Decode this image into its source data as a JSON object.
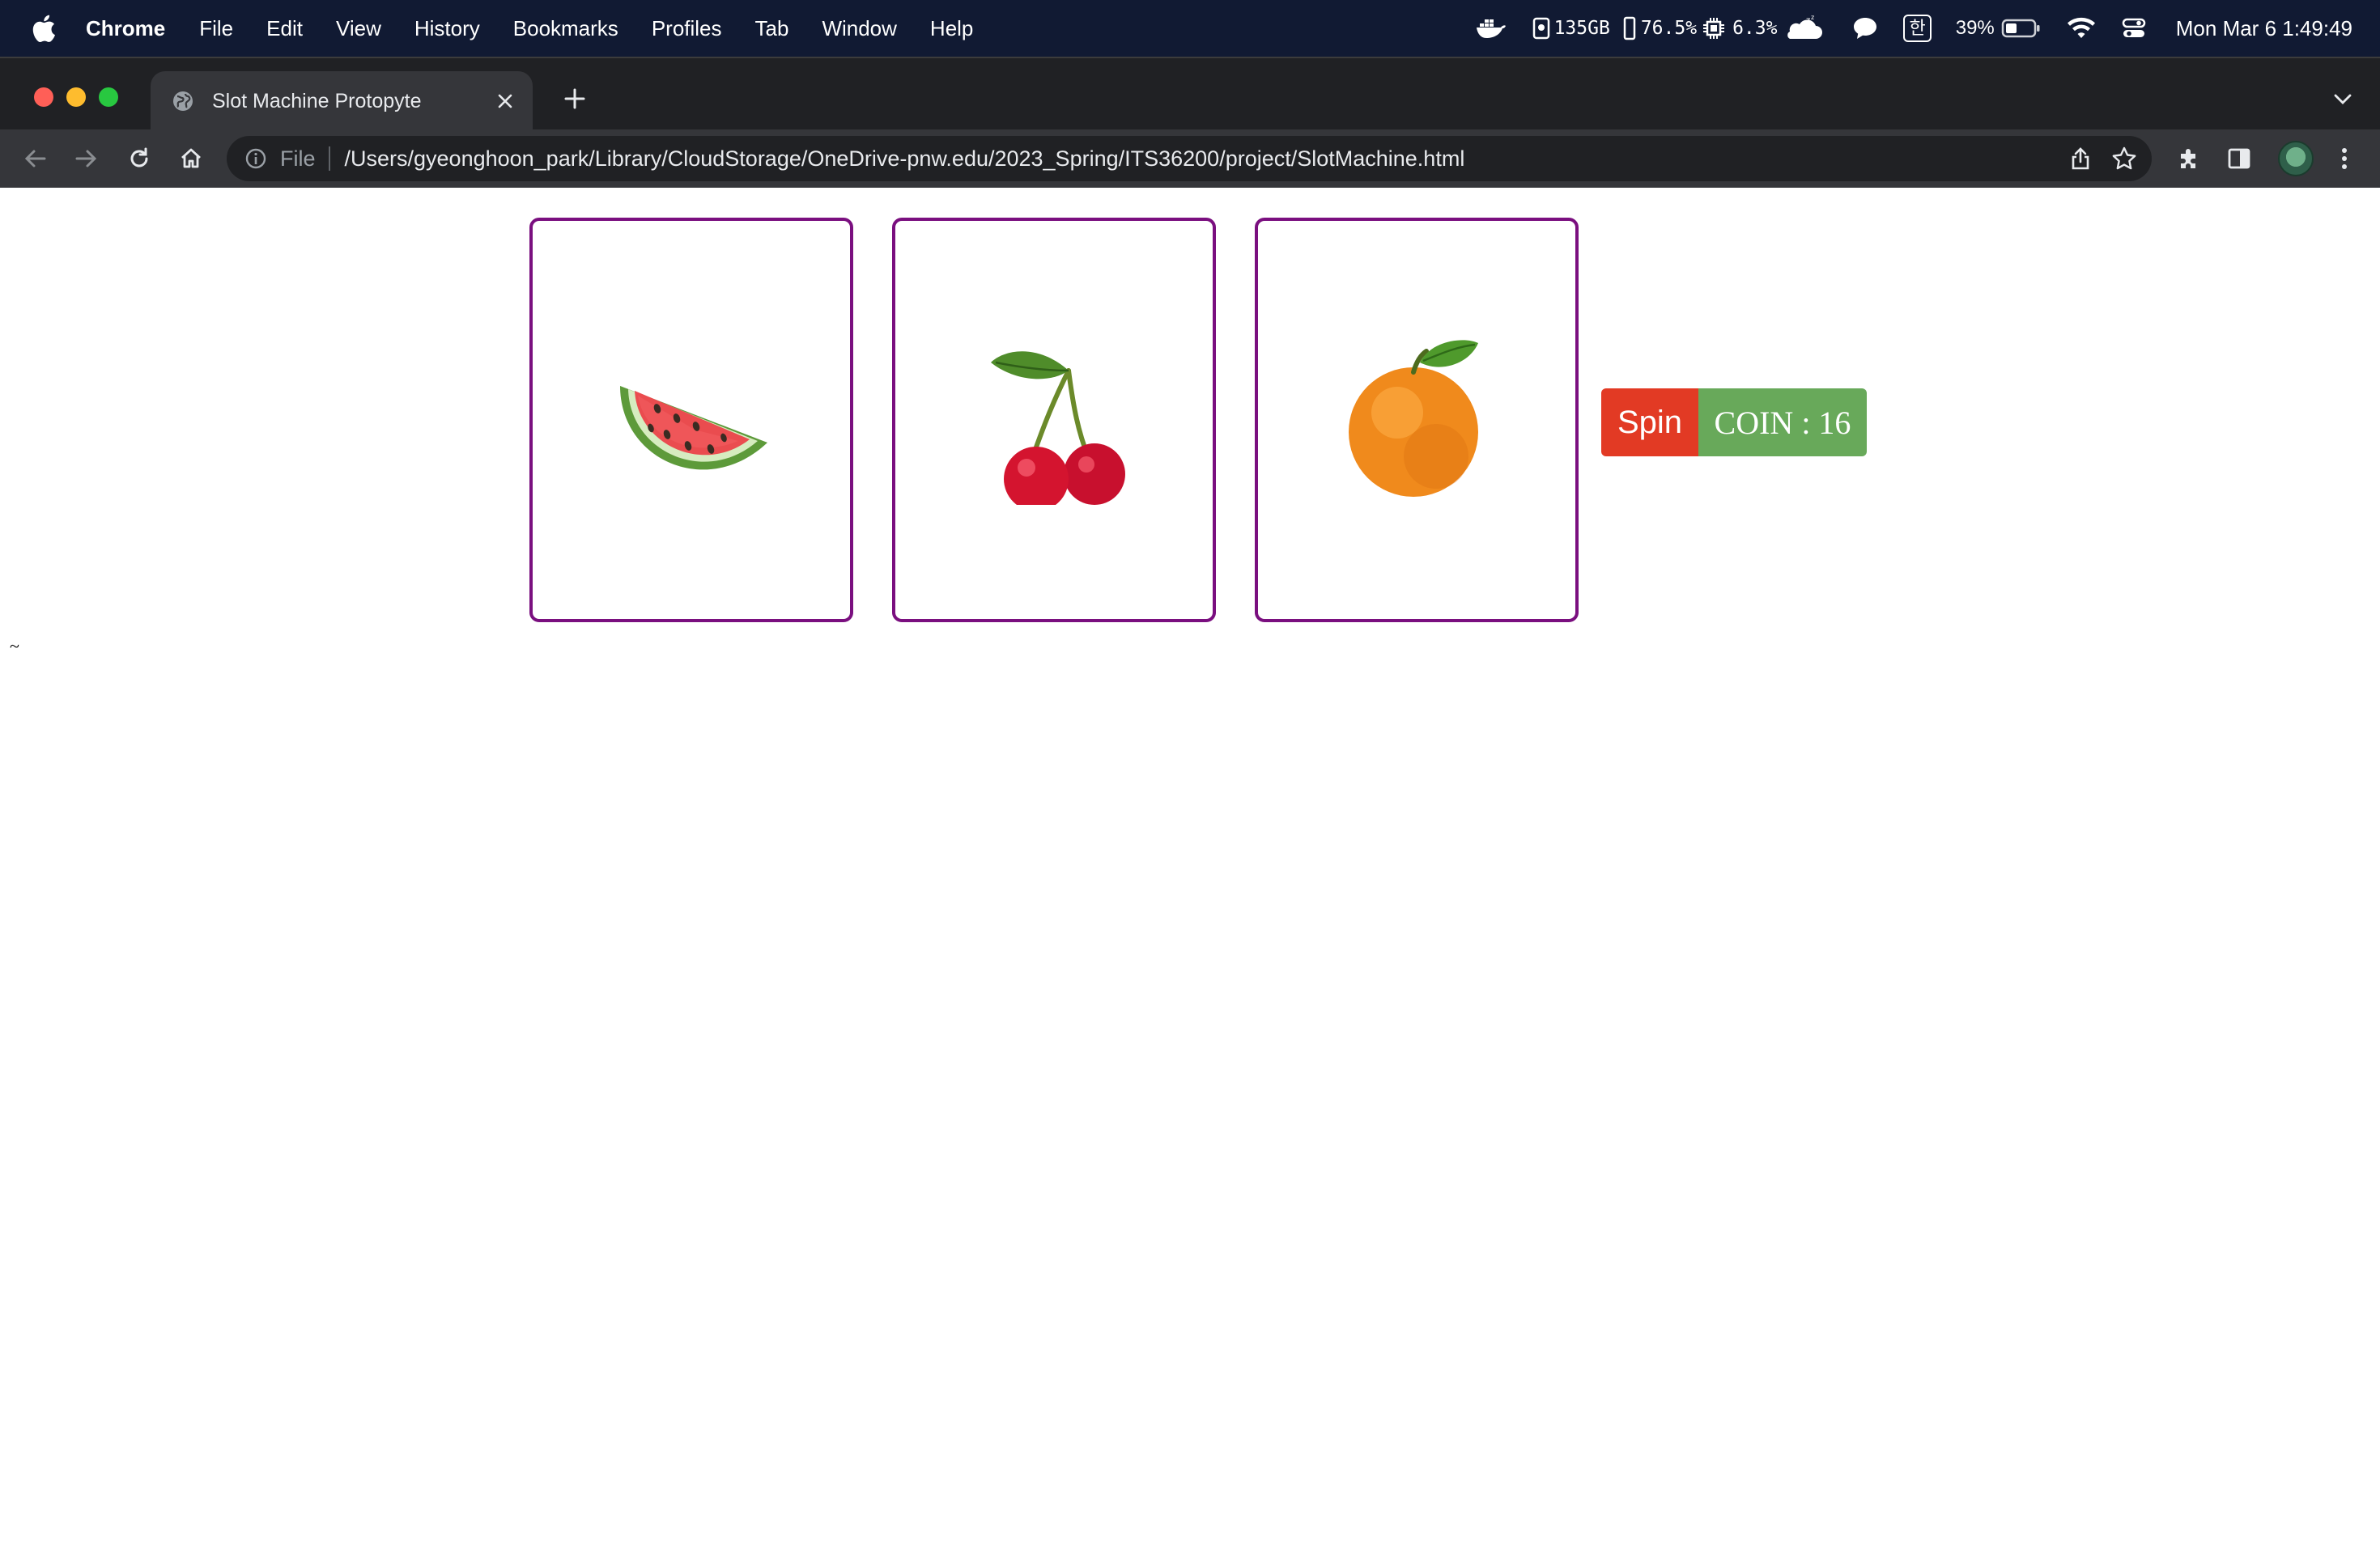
{
  "menubar": {
    "app_name": "Chrome",
    "items": [
      "File",
      "Edit",
      "View",
      "History",
      "Bookmarks",
      "Profiles",
      "Tab",
      "Window",
      "Help"
    ],
    "status": {
      "disk": "135GB",
      "memory": "76.5%",
      "cpu": "6.3%",
      "input_method": "한",
      "battery": "39%",
      "clock": "Mon Mar 6  1:49:49"
    }
  },
  "browser": {
    "tab_title": "Slot Machine Protopyte",
    "url_scheme": "File",
    "url": "/Users/gyeonghoon_park/Library/CloudStorage/OneDrive-pnw.edu/2023_Spring/ITS36200/project/SlotMachine.html"
  },
  "page": {
    "reels": [
      {
        "symbol": "watermelon-icon"
      },
      {
        "symbol": "cherry-icon"
      },
      {
        "symbol": "orange-icon"
      }
    ],
    "spin_label": "Spin",
    "coin_label": "COIN : 16",
    "stray_text": "~"
  },
  "colors": {
    "reel_border": "#7a0f7f",
    "spin_bg": "#e23a24",
    "coin_bg": "#68a95a",
    "menubar_bg": "#111a33"
  }
}
